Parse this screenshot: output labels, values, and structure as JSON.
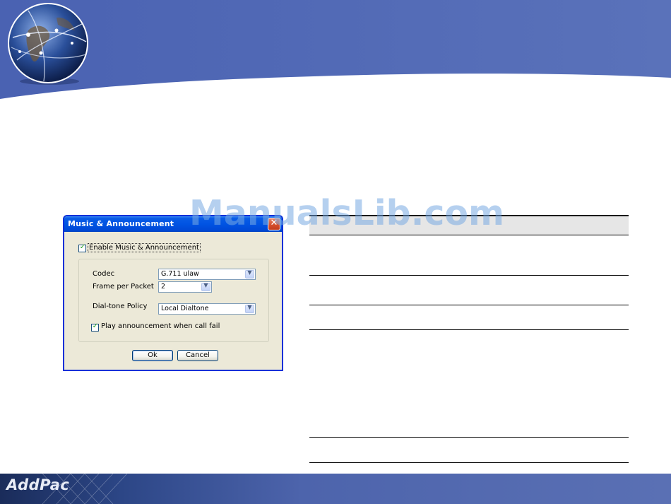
{
  "footer": {
    "logo_text": "AddPac"
  },
  "watermark": {
    "text": "ManualsLib.com"
  },
  "dialog": {
    "title": "Music & Announcement",
    "close_icon": "close-icon",
    "enable_checkbox": {
      "label": "Enable Music & Announcement",
      "checked": true
    },
    "fields": {
      "codec": {
        "label": "Codec",
        "value": "G.711 ulaw"
      },
      "frame_per_packet": {
        "label": "Frame per Packet",
        "value": "2"
      },
      "dialtone_policy": {
        "label": "Dial-tone Policy",
        "value": "Local Dialtone"
      }
    },
    "play_checkbox": {
      "label": "Play announcement when call fail",
      "checked": true
    },
    "buttons": {
      "ok": "Ok",
      "cancel": "Cancel"
    }
  },
  "colors": {
    "header_blue": "#5a70b4",
    "titlebar_blue": "#0054e3",
    "dialog_bg": "#ece9d8",
    "table_header_gray": "#e6e6e6"
  }
}
